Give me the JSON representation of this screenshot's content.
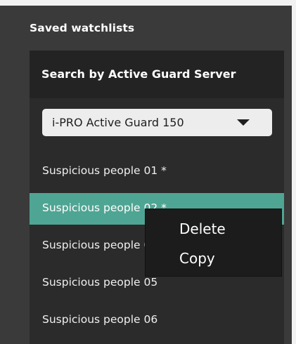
{
  "section": {
    "title": "Saved watchlists"
  },
  "panel": {
    "header_label": "Search by Active Guard Server",
    "server_select": {
      "value": "i-PRO Active Guard 150"
    },
    "watchlists": [
      {
        "label": "Suspicious people 01 *",
        "selected": false
      },
      {
        "label": "Suspicious people 02 *",
        "selected": true
      },
      {
        "label": "Suspicious people 03",
        "selected": false
      },
      {
        "label": "Suspicious people 05",
        "selected": false
      },
      {
        "label": "Suspicious people 06",
        "selected": false
      }
    ]
  },
  "context_menu": {
    "items": [
      {
        "label": "Delete"
      },
      {
        "label": "Copy"
      }
    ]
  },
  "colors": {
    "background": "#3a3a3a",
    "panel": "#2b2b2b",
    "panel_header": "#232323",
    "selection_accent": "#4fa593",
    "menu_background": "#1c1c1c"
  },
  "icons": {
    "dropdown": "chevron-down-icon"
  }
}
